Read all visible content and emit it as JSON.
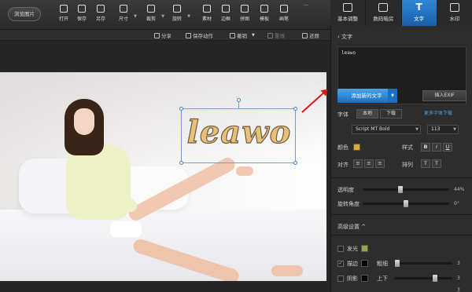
{
  "toolbar": {
    "browse_label": "浏览图片",
    "tools": [
      {
        "label": "打开",
        "icon": "open-icon"
      },
      {
        "label": "保存",
        "icon": "save-icon"
      },
      {
        "label": "另存",
        "icon": "save-as-icon"
      },
      {
        "label": "尺寸",
        "icon": "resize-icon"
      },
      {
        "label": "裁剪",
        "icon": "crop-icon"
      },
      {
        "label": "旋转",
        "icon": "rotate-icon"
      },
      {
        "label": "素材",
        "icon": "material-icon"
      },
      {
        "label": "边框",
        "icon": "frame-icon"
      },
      {
        "label": "拼图",
        "icon": "collage-icon"
      },
      {
        "label": "模板",
        "icon": "template-icon"
      },
      {
        "label": "画笔",
        "icon": "brush-icon"
      }
    ],
    "more": "..."
  },
  "right_tabs": [
    {
      "label": "基本调整",
      "icon": "adjust-icon"
    },
    {
      "label": "数码暗房",
      "icon": "camera-icon"
    },
    {
      "label": "文字",
      "icon": "text-icon"
    },
    {
      "label": "水印",
      "icon": "watermark-icon"
    }
  ],
  "subbar": {
    "share": "分享",
    "save_action": "保存动作",
    "undo": "撤销",
    "redo": "重做",
    "restore": "还原"
  },
  "canvas": {
    "watermark_text": "leawo"
  },
  "panel": {
    "section_title": "文字",
    "text_value": "leawo",
    "add_text_button": "添加新的文字",
    "insert_exif_button": "插入EXIF",
    "font_label": "字体",
    "local_tab": "本地",
    "download_tab": "下载",
    "more_fonts_link": "更多字体下载",
    "font_name": "Script MT Bold",
    "font_size": "113",
    "color_label": "颜色",
    "text_color": "#e0a834",
    "style_label": "样式",
    "bold": "B",
    "italic": "I",
    "underline": "U",
    "align_label": "对齐",
    "arrange_label": "排列",
    "opacity_label": "透明度",
    "opacity_value": "44%",
    "opacity_fraction": 0.44,
    "rotation_label": "旋转角度",
    "rotation_value": "0°",
    "advanced_title": "高级设置",
    "glow_label": "发光",
    "glow_color": "#9aa54a",
    "stroke_label": "描边",
    "stroke_color": "#000000",
    "thickness_label": "粗细",
    "thickness_value": "3",
    "shadow_label": "阴影",
    "shadow_color": "#000000",
    "updown_label": "上下",
    "updown_value": "3",
    "extra_value": "3"
  }
}
